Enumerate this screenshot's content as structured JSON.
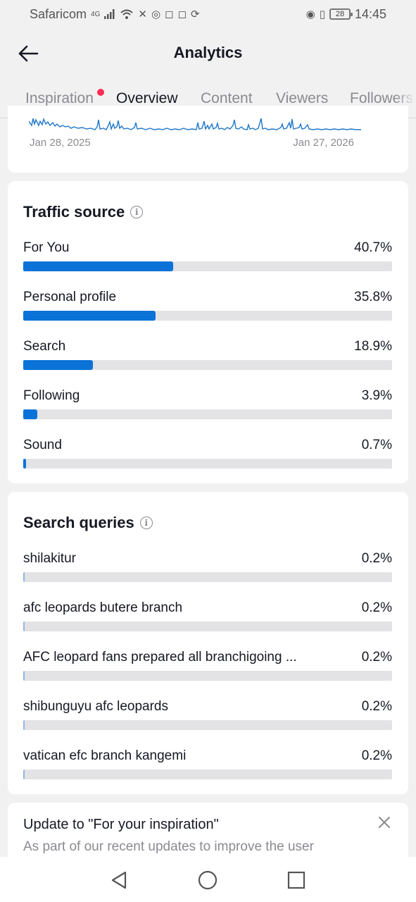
{
  "status_bar": {
    "carrier": "Safaricom",
    "network": "4G",
    "battery": "28",
    "time": "14:45"
  },
  "header": {
    "title": "Analytics"
  },
  "tabs": [
    {
      "label": "Inspiration",
      "has_badge": true
    },
    {
      "label": "Overview",
      "active": true
    },
    {
      "label": "Content"
    },
    {
      "label": "Viewers"
    },
    {
      "label": "Followers"
    }
  ],
  "chart": {
    "start_label": "Jan 28, 2025",
    "end_label": "Jan 27, 2026",
    "line_color": "#1f77c9"
  },
  "traffic_source": {
    "title": "Traffic source",
    "items": [
      {
        "label": "For You",
        "value": "40.7%",
        "pct": 40.7
      },
      {
        "label": "Personal profile",
        "value": "35.8%",
        "pct": 35.8
      },
      {
        "label": "Search",
        "value": "18.9%",
        "pct": 18.9
      },
      {
        "label": "Following",
        "value": "3.9%",
        "pct": 3.9
      },
      {
        "label": "Sound",
        "value": "0.7%",
        "pct": 0.7
      }
    ]
  },
  "search_queries": {
    "title": "Search queries",
    "items": [
      {
        "label": "shilakitur",
        "value": "0.2%",
        "pct": 0.2
      },
      {
        "label": "afc leopards butere branch",
        "value": "0.2%",
        "pct": 0.2
      },
      {
        "label": "AFC leopard fans prepared all branchigoing ...",
        "value": "0.2%",
        "pct": 0.2
      },
      {
        "label": "shibunguyu afc leopards",
        "value": "0.2%",
        "pct": 0.2
      },
      {
        "label": "vatican efc branch kangemi",
        "value": "0.2%",
        "pct": 0.2
      }
    ]
  },
  "update_card": {
    "title": "Update to \"For your inspiration\"",
    "text": "As part of our recent updates to improve the user"
  },
  "colors": {
    "bar_fill": "#0b72d8",
    "track": "#e3e3e5",
    "badge": "#fe2c55"
  }
}
